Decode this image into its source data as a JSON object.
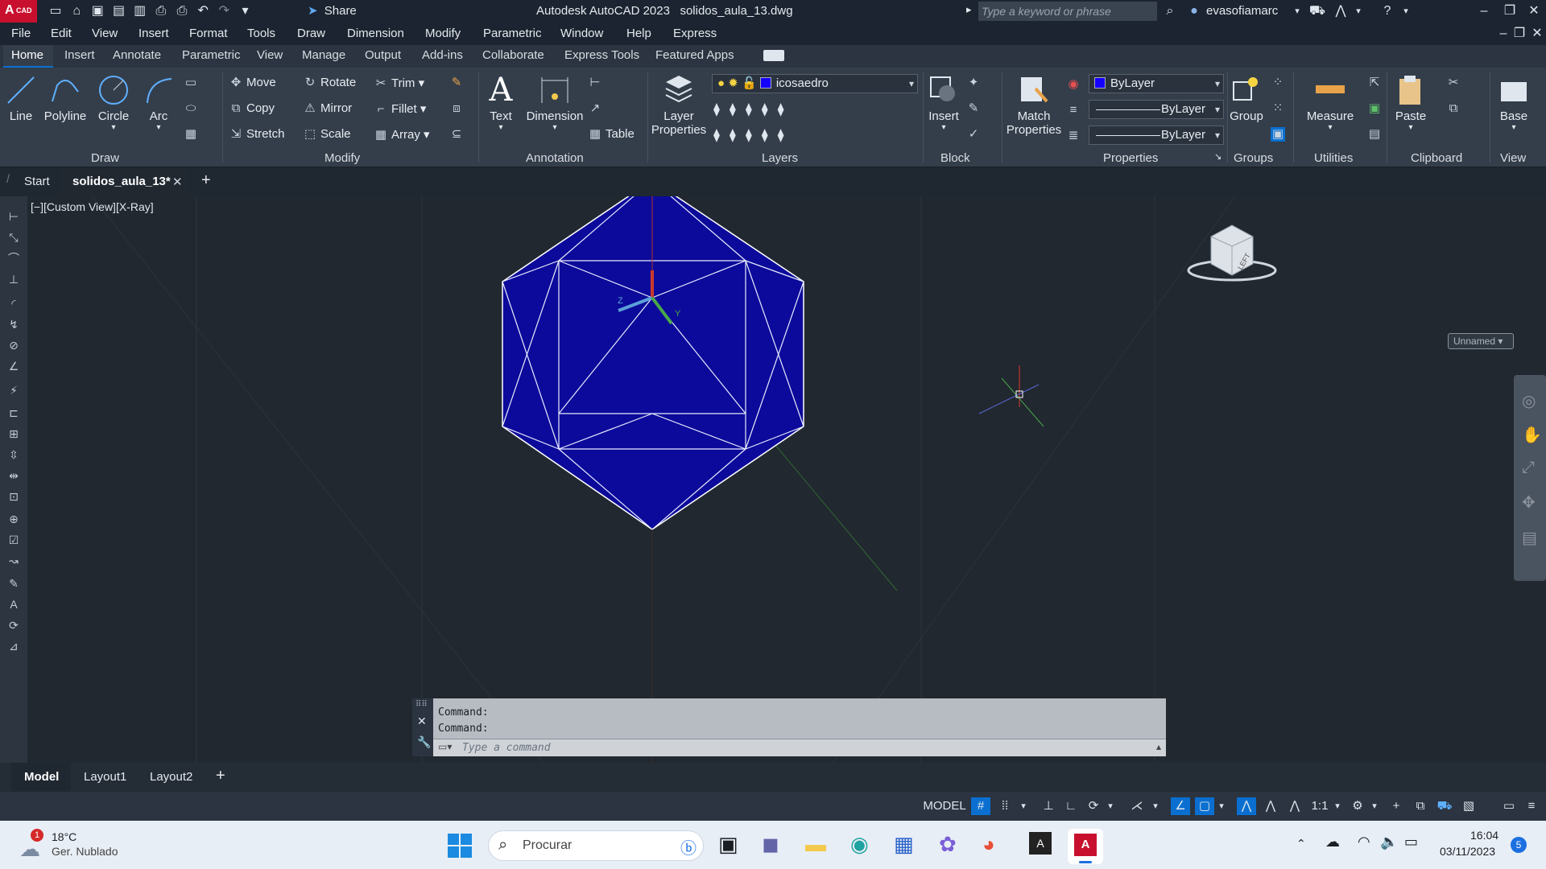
{
  "titlebar": {
    "app_badge": "A",
    "app_badge_sub": "CAD",
    "share_label": "Share",
    "title": "Autodesk AutoCAD 2023   solidos_aula_13.dwg",
    "search_placeholder": "Type a keyword or phrase",
    "username": "evasofiamarc"
  },
  "menubar": [
    "File",
    "Edit",
    "View",
    "Insert",
    "Format",
    "Tools",
    "Draw",
    "Dimension",
    "Modify",
    "Parametric",
    "Window",
    "Help",
    "Express"
  ],
  "ribbon_tabs": [
    "Home",
    "Insert",
    "Annotate",
    "Parametric",
    "View",
    "Manage",
    "Output",
    "Add-ins",
    "Collaborate",
    "Express Tools",
    "Featured Apps"
  ],
  "ribbon": {
    "draw": {
      "line": "Line",
      "polyline": "Polyline",
      "circle": "Circle",
      "arc": "Arc",
      "title": "Draw"
    },
    "modify": {
      "move": "Move",
      "rotate": "Rotate",
      "trim": "Trim",
      "copy": "Copy",
      "mirror": "Mirror",
      "fillet": "Fillet",
      "stretch": "Stretch",
      "scale": "Scale",
      "array": "Array",
      "title": "Modify"
    },
    "annotation": {
      "text": "Text",
      "dimension": "Dimension",
      "table": "Table",
      "title": "Annotation"
    },
    "layers": {
      "layer_properties_1": "Layer",
      "layer_properties_2": "Properties",
      "current_layer": "icosaedro",
      "title": "Layers"
    },
    "block": {
      "insert": "Insert",
      "title": "Block"
    },
    "properties": {
      "match_1": "Match",
      "match_2": "Properties",
      "color": "ByLayer",
      "lineweight": "ByLayer",
      "linetype": "ByLayer",
      "title": "Properties"
    },
    "groups": {
      "group": "Group",
      "title": "Groups"
    },
    "utilities": {
      "measure": "Measure",
      "title": "Utilities"
    },
    "clipboard": {
      "paste": "Paste",
      "title": "Clipboard"
    },
    "view": {
      "base": "Base",
      "title": "View"
    }
  },
  "doctabs": {
    "start": "Start",
    "active": "solidos_aula_13*"
  },
  "viewport": {
    "label": "[−][Custom View][X-Ray]",
    "viewcube_face": "LEFT",
    "named_view": "Unnamed",
    "ucs_z": "Z",
    "ucs_y": "Y"
  },
  "command": {
    "line1": "Command:",
    "line2": "Command:",
    "placeholder": "Type a command"
  },
  "layouttabs": [
    "Model",
    "Layout1",
    "Layout2"
  ],
  "statusbar": {
    "model": "MODEL",
    "scale": "1:1"
  },
  "taskbar": {
    "weather_temp": "18°C",
    "weather_desc": "Ger. Nublado",
    "weather_badge": "1",
    "search": "Procurar",
    "time": "16:04",
    "date": "03/11/2023",
    "notif_count": "5"
  },
  "colors": {
    "solid_fill": "#0c0a9a",
    "accent": "#0a6fd0",
    "layer_swatch": "#1400ff"
  }
}
